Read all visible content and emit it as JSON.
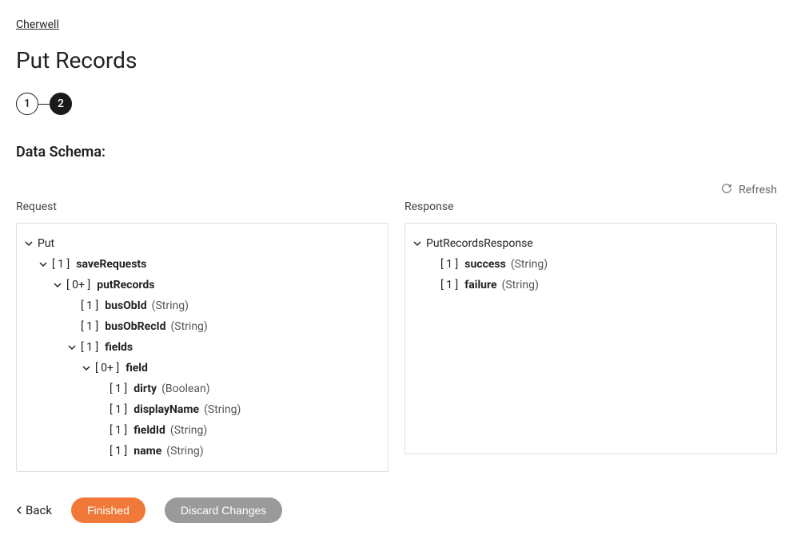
{
  "breadcrumb": {
    "label": "Cherwell"
  },
  "page": {
    "title": "Put Records",
    "section_title": "Data Schema:"
  },
  "stepper": {
    "step1": "1",
    "step2": "2"
  },
  "refresh": {
    "label": "Refresh"
  },
  "columns": {
    "request_label": "Request",
    "response_label": "Response"
  },
  "request_tree": {
    "root": "Put",
    "saveRequests": {
      "card": "[ 1 ]",
      "name": "saveRequests"
    },
    "putRecords": {
      "card": "[ 0+ ]",
      "name": "putRecords"
    },
    "busObId": {
      "card": "[ 1 ]",
      "name": "busObId",
      "type": "(String)"
    },
    "busObRecId": {
      "card": "[ 1 ]",
      "name": "busObRecId",
      "type": "(String)"
    },
    "fields": {
      "card": "[ 1 ]",
      "name": "fields"
    },
    "field": {
      "card": "[ 0+ ]",
      "name": "field"
    },
    "dirty": {
      "card": "[ 1 ]",
      "name": "dirty",
      "type": "(Boolean)"
    },
    "displayName": {
      "card": "[ 1 ]",
      "name": "displayName",
      "type": "(String)"
    },
    "fieldId": {
      "card": "[ 1 ]",
      "name": "fieldId",
      "type": "(String)"
    },
    "name": {
      "card": "[ 1 ]",
      "name": "name",
      "type": "(String)"
    }
  },
  "response_tree": {
    "root": "PutRecordsResponse",
    "success": {
      "card": "[ 1 ]",
      "name": "success",
      "type": "(String)"
    },
    "failure": {
      "card": "[ 1 ]",
      "name": "failure",
      "type": "(String)"
    }
  },
  "footer": {
    "back": "Back",
    "finished": "Finished",
    "discard": "Discard Changes"
  }
}
